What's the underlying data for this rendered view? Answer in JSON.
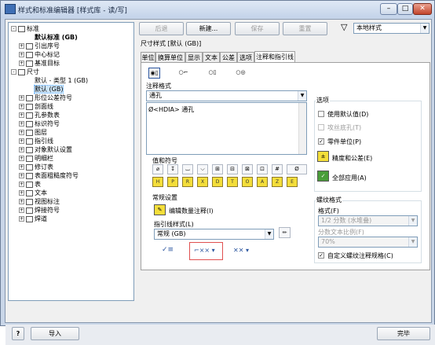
{
  "window": {
    "title": "样式和标准编辑器 [样式库 - 读/写]"
  },
  "tree": [
    {
      "label": "标准",
      "pm": "-",
      "icon": "standard-icon",
      "bold": false
    },
    {
      "label": "默认标准 (GB)",
      "pm": "",
      "icon": "",
      "bold": true
    },
    {
      "label": "引出序号",
      "pm": "+",
      "icon": "balloon-icon"
    },
    {
      "label": "中心标记",
      "pm": "+",
      "icon": "center-mark-icon"
    },
    {
      "label": "基准目标",
      "pm": "+",
      "icon": "datum-target-icon"
    },
    {
      "label": "尺寸",
      "pm": "-",
      "icon": "dimension-icon"
    },
    {
      "label": "默认 - 类型 1 (GB)",
      "pm": "",
      "icon": ""
    },
    {
      "label": "默认 (GB)",
      "pm": "",
      "icon": "",
      "selected": true
    },
    {
      "label": "形位公差符号",
      "pm": "+",
      "icon": "fcf-icon"
    },
    {
      "label": "剖面线",
      "pm": "+",
      "icon": "hatch-icon"
    },
    {
      "label": "孔参数表",
      "pm": "+",
      "icon": "hole-table-icon"
    },
    {
      "label": "标识符号",
      "pm": "+",
      "icon": "id-symbol-icon"
    },
    {
      "label": "图层",
      "pm": "+",
      "icon": "layer-icon"
    },
    {
      "label": "指引线",
      "pm": "+",
      "icon": "leader-icon"
    },
    {
      "label": "对象默认设置",
      "pm": "+",
      "icon": "object-defaults-icon"
    },
    {
      "label": "明细栏",
      "pm": "+",
      "icon": "parts-list-icon"
    },
    {
      "label": "修订表",
      "pm": "+",
      "icon": "revision-table-icon"
    },
    {
      "label": "表面粗糙度符号",
      "pm": "+",
      "icon": "surface-texture-icon"
    },
    {
      "label": "表",
      "pm": "+",
      "icon": "table-icon"
    },
    {
      "label": "文本",
      "pm": "+",
      "icon": "text-icon"
    },
    {
      "label": "视图标注",
      "pm": "+",
      "icon": "view-annotation-icon"
    },
    {
      "label": "焊接符号",
      "pm": "+",
      "icon": "weld-symbol-icon"
    },
    {
      "label": "焊道",
      "pm": "+",
      "icon": "weld-bead-icon"
    }
  ],
  "toolbar": {
    "back": "后退",
    "new": "新建...",
    "save": "保存",
    "reset": "重置",
    "filter": "本地样式"
  },
  "style_title": "尺寸样式 [默认 (GB)]",
  "tabs": [
    "单位",
    "换算单位",
    "显示",
    "文本",
    "公差",
    "选项",
    "注释和指引线"
  ],
  "annotation": {
    "group": "注释格式",
    "type_value": "通孔",
    "text_value": "Ø<HDIA> 通孔",
    "values_symbols": "值和符号",
    "symbols_row1": [
      "⌀",
      "↧",
      "⌴",
      "⌵",
      "⊞",
      "⊟",
      "⊠",
      "⊡",
      "#",
      "Ø"
    ],
    "symbols_row2": [
      "H",
      "P",
      "R",
      "X",
      "D",
      "T",
      "O",
      "A",
      "Z",
      "E"
    ]
  },
  "common": {
    "group": "常规设置",
    "edit_qty_note": "编辑数量注释(I)",
    "leader_style_label": "指引线样式(L)",
    "leader_style_value": "常规 (GB)"
  },
  "options": {
    "group": "选项",
    "use_default": "使用默认值(D)",
    "thread_bottom": "攻丝底孔(T)",
    "zero_units": "零件单位(P)",
    "precision_tolerance": "精度和公差(E)",
    "apply_all": "全部应用(A)"
  },
  "thread": {
    "group": "螺纹格式",
    "format_label": "格式(F)",
    "format_value": "1/2 分数 (水堆叠)",
    "scale_label": "分数文本比例(F)",
    "scale_value": "70%",
    "custom": "自定义螺纹注释规格(C)"
  },
  "footer": {
    "help": "?",
    "import": "导入",
    "done": "完毕"
  }
}
